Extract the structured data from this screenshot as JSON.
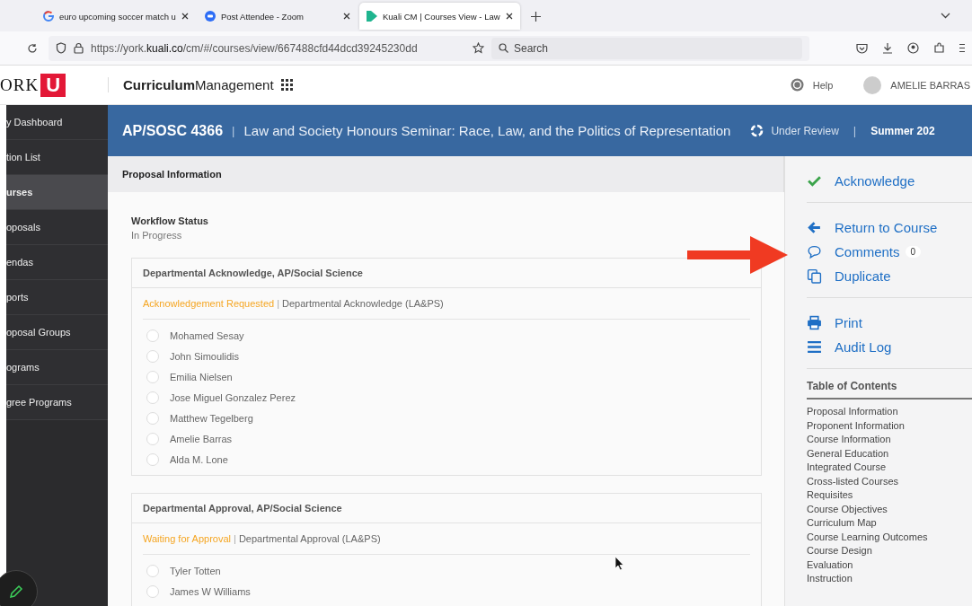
{
  "browser": {
    "tabs": [
      {
        "title": "euro upcoming soccer match u",
        "selected": false
      },
      {
        "title": "Post Attendee - Zoom",
        "selected": false
      },
      {
        "title": "Kuali CM | Courses View - Law",
        "selected": true
      }
    ],
    "url": "https://york.**kuali.co**/cm/#/courses/view/667488cfd44dcd39245230dd",
    "search_placeholder": "Search"
  },
  "header": {
    "logo_letters": "ORK",
    "logo_mark": "U",
    "product": "**Curriculum**Management",
    "help": "Help",
    "user": "AMELIE BARRAS"
  },
  "sidebar": {
    "items": [
      {
        "label": "y Dashboard",
        "selected": false
      },
      {
        "label": "tion List",
        "selected": false
      },
      {
        "label": "urses",
        "selected": true
      },
      {
        "label": "oposals",
        "selected": false
      },
      {
        "label": "endas",
        "selected": false
      },
      {
        "label": "ports",
        "selected": false
      },
      {
        "label": "oposal Groups",
        "selected": false
      },
      {
        "label": "ograms",
        "selected": false
      },
      {
        "label": "gree Programs",
        "selected": false
      }
    ]
  },
  "course": {
    "code": "AP/SOSC 4366",
    "separator": "|",
    "title": "Law and Society Honours Seminar: Race, Law, and the Politics of Representation",
    "status": "Under Review",
    "separator2": "|",
    "term": "Summer 202"
  },
  "main": {
    "section_title": "Proposal Information",
    "workflow_label": "Workflow Status",
    "workflow_value": "In Progress",
    "steps": [
      {
        "title": "Departmental Acknowledge, AP/Social Science",
        "status": "Acknowledgement Requested",
        "divider": "|",
        "role": "Departmental Acknowledge (LA&PS)",
        "people": [
          {
            "name": "Mohamed Sesay",
            "checked": false
          },
          {
            "name": "John Simoulidis",
            "checked": false
          },
          {
            "name": "Emilia Nielsen",
            "checked": false
          },
          {
            "name": "Jose Miguel Gonzalez Perez",
            "checked": false
          },
          {
            "name": "Matthew Tegelberg",
            "checked": false
          },
          {
            "name": "Amelie Barras",
            "checked": false
          },
          {
            "name": "Alda M. Lone",
            "checked": false
          }
        ]
      },
      {
        "title": "Departmental Approval, AP/Social Science",
        "status": "Waiting for Approval",
        "divider": "|",
        "role": "Departmental Approval (LA&PS)",
        "people": [
          {
            "name": "Tyler Totten",
            "checked": false
          },
          {
            "name": "James W Williams",
            "checked": false
          }
        ]
      }
    ]
  },
  "actions": {
    "groups": [
      [
        {
          "kind": "check",
          "label": "Acknowledge"
        }
      ],
      [
        {
          "kind": "back",
          "label": "Return to Course"
        },
        {
          "kind": "comment",
          "label": "Comments",
          "count": "0"
        },
        {
          "kind": "duplicate",
          "label": "Duplicate"
        }
      ],
      [
        {
          "kind": "print",
          "label": "Print"
        },
        {
          "kind": "list",
          "label": "Audit Log"
        }
      ]
    ]
  },
  "toc": {
    "title": "Table of Contents",
    "items": [
      "Proposal Information",
      "Proponent Information",
      "Course Information",
      "General Education",
      "Integrated Course",
      "Cross-listed Courses",
      "Requisites",
      "Course Objectives",
      "Curriculum Map",
      "Course Learning Outcomes",
      "Course Design",
      "Evaluation",
      "Instruction"
    ]
  }
}
